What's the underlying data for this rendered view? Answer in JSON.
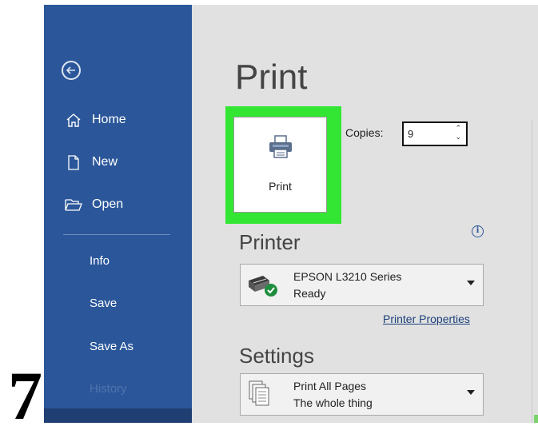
{
  "sidebar": {
    "back_icon": "arrow-left-circle-icon",
    "items": [
      {
        "label": "Home",
        "icon": "home-icon"
      },
      {
        "label": "New",
        "icon": "new-document-icon"
      },
      {
        "label": "Open",
        "icon": "folder-open-icon"
      }
    ],
    "text_items": [
      "Info",
      "Save",
      "Save As",
      "History"
    ]
  },
  "main": {
    "title": "Print",
    "print_button_label": "Print",
    "copies_label": "Copies:",
    "copies_value": "9",
    "printer_section": "Printer",
    "printer_name": "EPSON L3210 Series",
    "printer_status": "Ready",
    "printer_properties_link": "Printer Properties",
    "settings_section": "Settings",
    "settings_pages": "Print All Pages",
    "settings_pages_sub": "The whole thing"
  },
  "step_number": "7",
  "colors": {
    "sidebar": "#2b579a",
    "highlight": "#33e633",
    "main_bg": "#e1e1e1"
  }
}
